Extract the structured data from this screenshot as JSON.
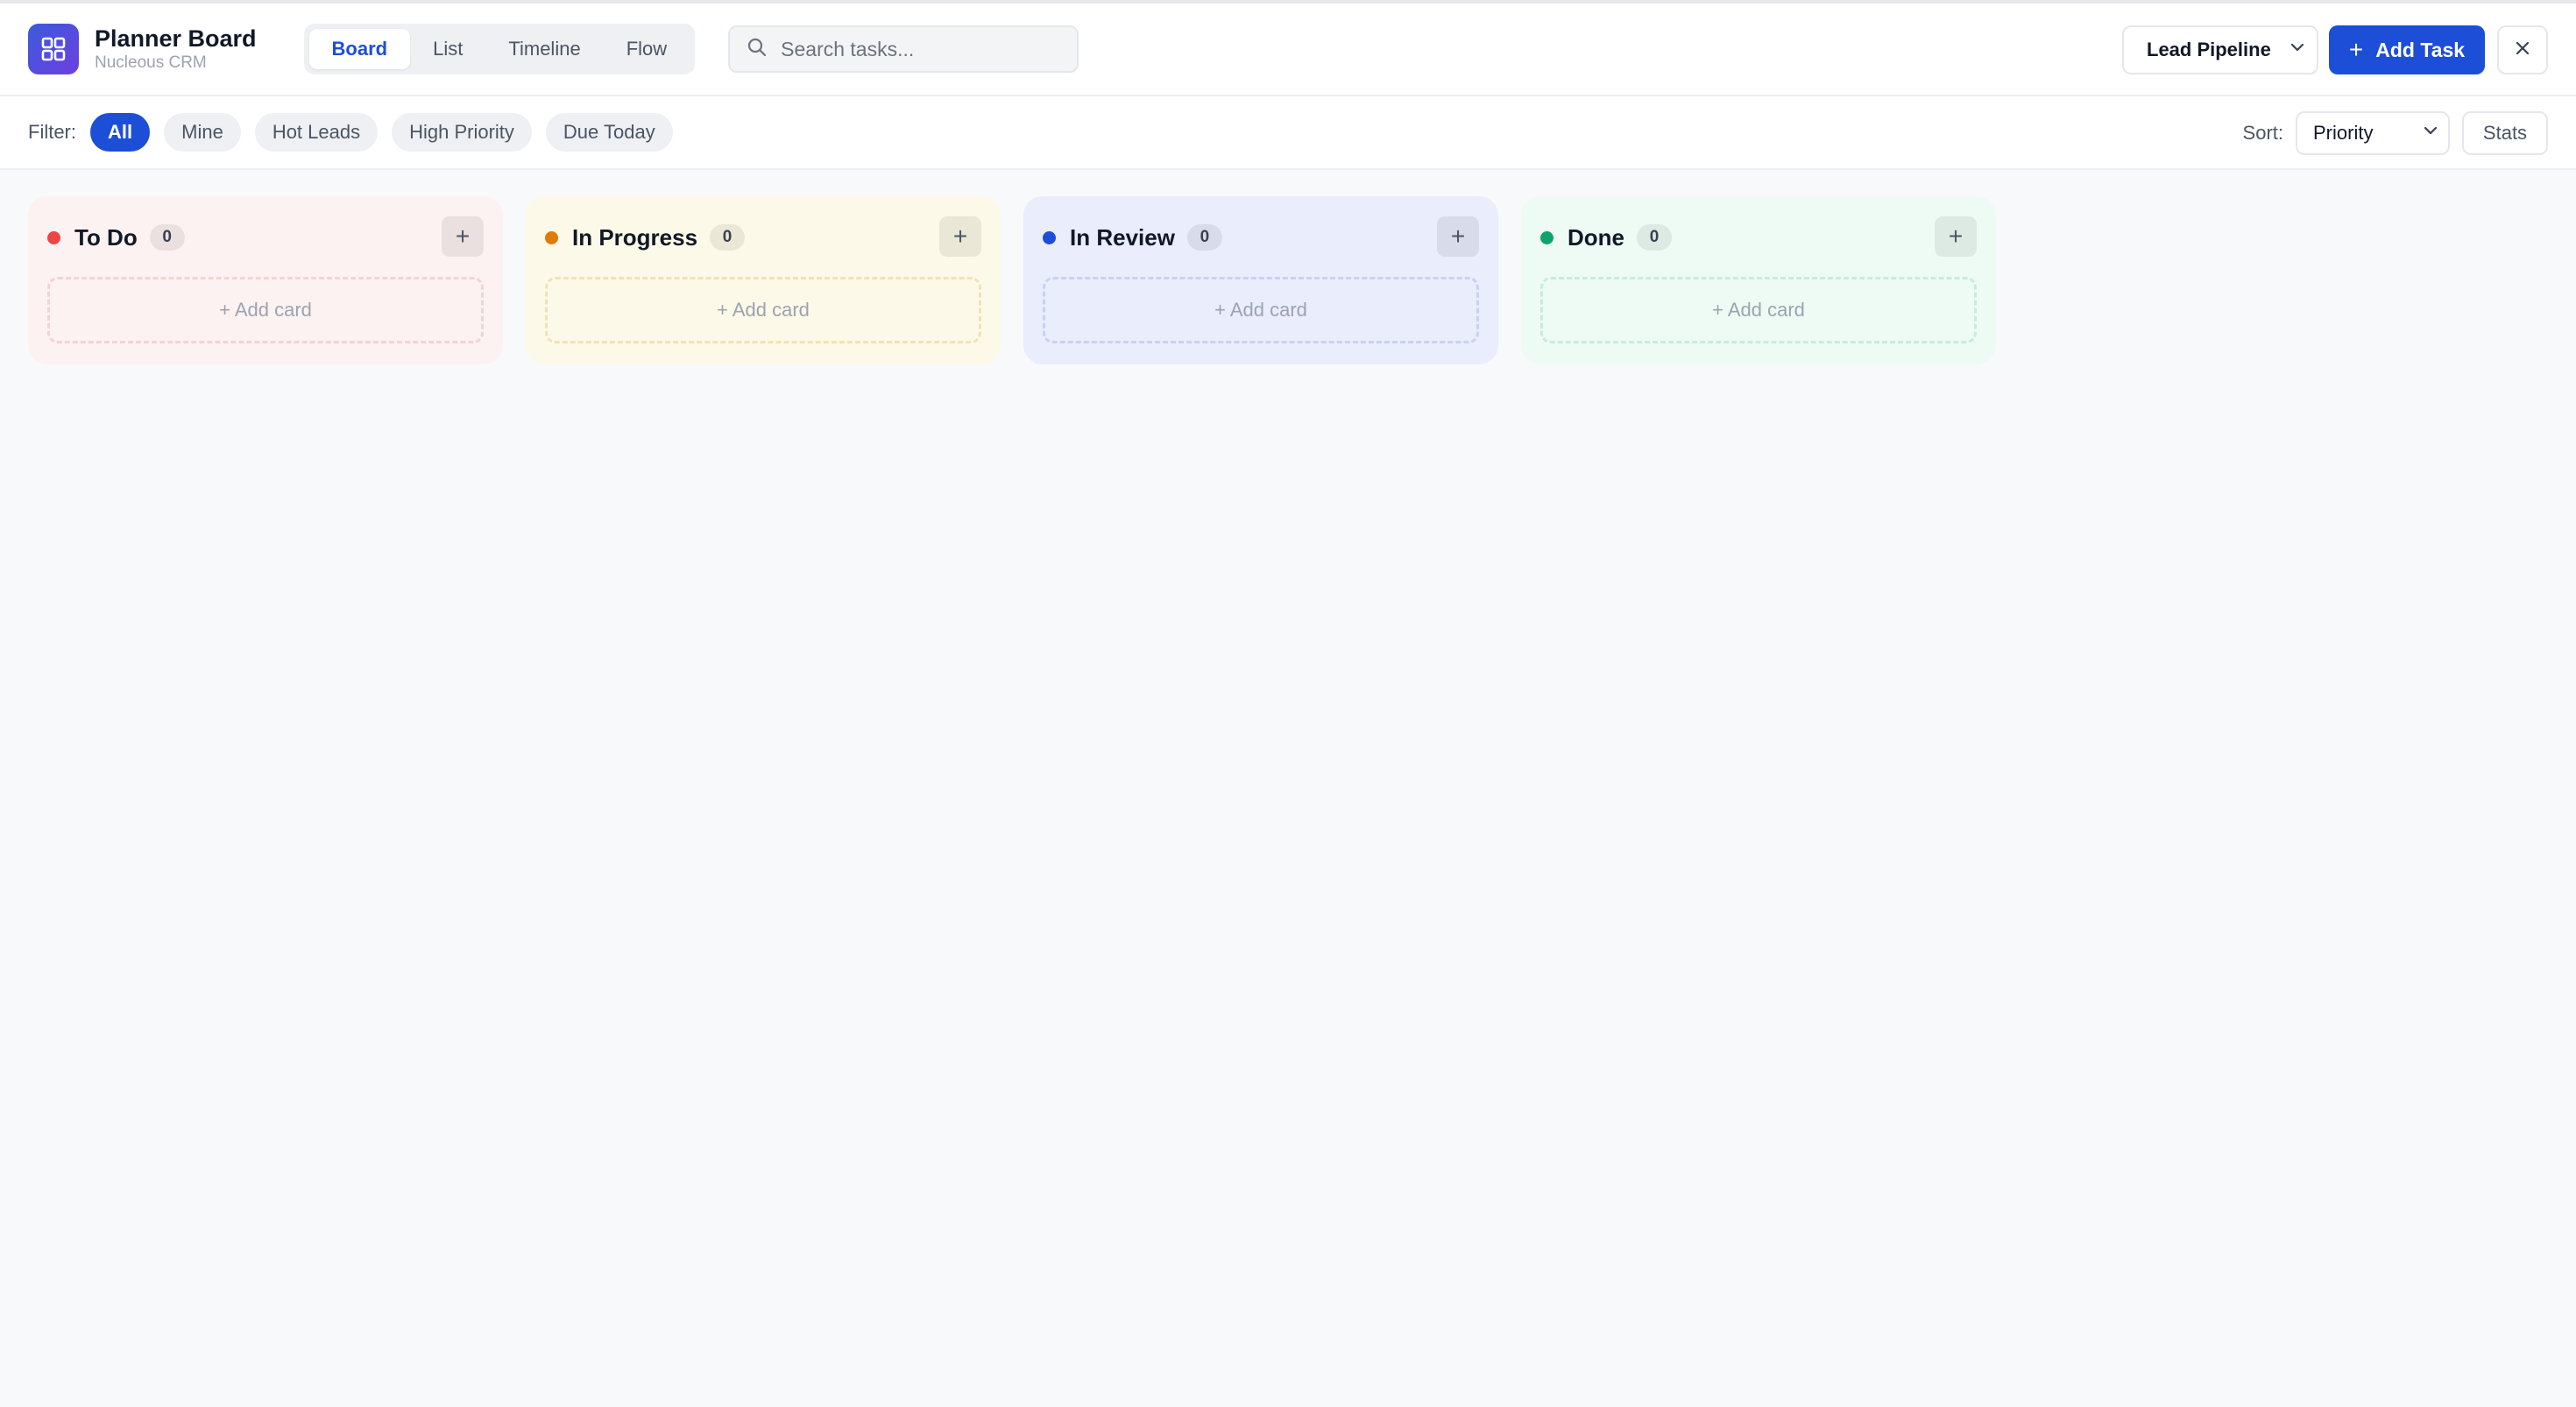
{
  "app": {
    "title": "Planner Board",
    "subtitle": "Nucleous CRM"
  },
  "view_tabs": [
    {
      "label": "Board",
      "active": true
    },
    {
      "label": "List",
      "active": false
    },
    {
      "label": "Timeline",
      "active": false
    },
    {
      "label": "Flow",
      "active": false
    }
  ],
  "search": {
    "placeholder": "Search tasks...",
    "value": ""
  },
  "pipeline": {
    "selected": "Lead Pipeline"
  },
  "actions": {
    "add_task": "Add Task"
  },
  "filter": {
    "label": "Filter:",
    "chips": [
      {
        "label": "All",
        "active": true
      },
      {
        "label": "Mine",
        "active": false
      },
      {
        "label": "Hot Leads",
        "active": false
      },
      {
        "label": "High Priority",
        "active": false
      },
      {
        "label": "Due Today",
        "active": false
      }
    ]
  },
  "sort": {
    "label": "Sort:",
    "selected": "Priority",
    "stats_label": "Stats"
  },
  "columns": [
    {
      "title": "To Do",
      "count": "0",
      "dot_color": "#ef4444",
      "bg": "#fdf2f2",
      "border": "#f4d2d2",
      "add_card": "+ Add card"
    },
    {
      "title": "In Progress",
      "count": "0",
      "dot_color": "#e07b0a",
      "bg": "#fdf9e8",
      "border": "#f1e3b4",
      "add_card": "+ Add card"
    },
    {
      "title": "In Review",
      "count": "0",
      "dot_color": "#1d4ed8",
      "bg": "#e9edfc",
      "border": "#c9d2f3",
      "add_card": "+ Add card"
    },
    {
      "title": "Done",
      "count": "0",
      "dot_color": "#10a36b",
      "bg": "#eefbf5",
      "border": "#c7ecda",
      "add_card": "+ Add card"
    }
  ],
  "colors": {
    "accent": "#1d4ed8",
    "logo_gradient_start": "#3b5bdb",
    "logo_gradient_end": "#6d3fe0"
  },
  "icons": {
    "logo": "grid-icon",
    "search": "search-icon",
    "chevron": "chevron-down-icon",
    "close": "close-icon",
    "plus": "plus-icon"
  }
}
